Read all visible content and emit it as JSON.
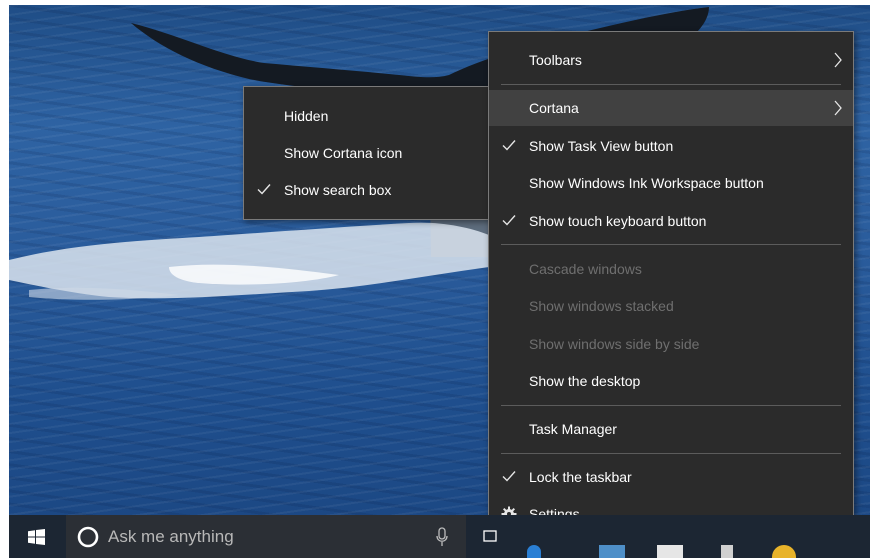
{
  "taskbar": {
    "search_placeholder": "Ask me anything"
  },
  "context_menu": {
    "toolbars": "Toolbars",
    "cortana": "Cortana",
    "show_task_view": "Show Task View button",
    "show_ink_workspace": "Show Windows Ink Workspace button",
    "show_touch_keyboard": "Show touch keyboard button",
    "cascade_windows": "Cascade windows",
    "show_stacked": "Show windows stacked",
    "show_side_by_side": "Show windows side by side",
    "show_desktop": "Show the desktop",
    "task_manager": "Task Manager",
    "lock_taskbar": "Lock the taskbar",
    "settings": "Settings"
  },
  "cortana_submenu": {
    "hidden": "Hidden",
    "show_cortana_icon": "Show Cortana icon",
    "show_search_box": "Show search box"
  },
  "colors": {
    "menu_bg": "#2b2b2b",
    "menu_highlight": "#414141",
    "disabled_text": "#6f6f6f",
    "taskbar_bg": "#1c2633"
  },
  "icons": [
    "check-icon",
    "chevron-right-icon",
    "gear-icon",
    "windows-logo-icon",
    "cortana-icon",
    "microphone-icon",
    "task-view-icon"
  ]
}
